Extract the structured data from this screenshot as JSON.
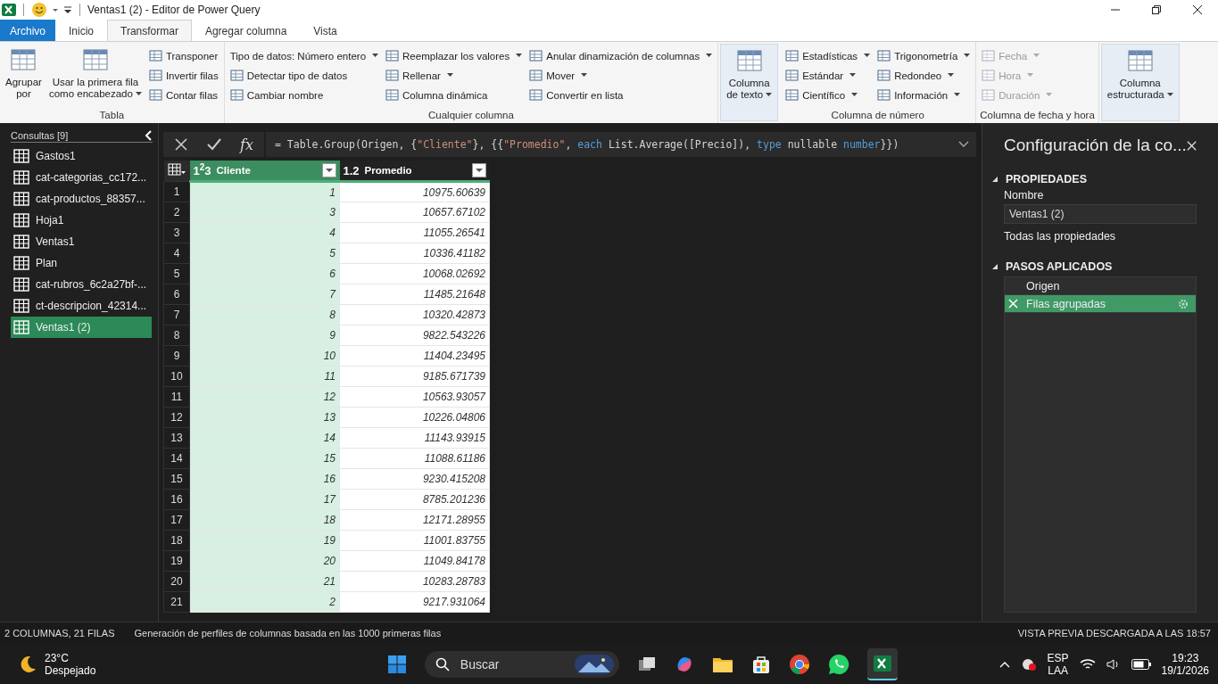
{
  "window": {
    "title": "Ventas1 (2) - Editor de Power Query"
  },
  "tabs": [
    {
      "label": "Archivo",
      "kind": "file",
      "selected": false
    },
    {
      "label": "Inicio",
      "kind": "tab",
      "selected": false
    },
    {
      "label": "Transformar",
      "kind": "tab",
      "selected": true
    },
    {
      "label": "Agregar columna",
      "kind": "tab",
      "selected": false
    },
    {
      "label": "Vista",
      "kind": "tab",
      "selected": false
    }
  ],
  "ribbon": [
    {
      "label": "Tabla",
      "highlighted": false,
      "columns": [
        {
          "kind": "large",
          "items": [
            {
              "label": "Agrupar\npor",
              "dropdown": false,
              "disabled": false
            }
          ]
        },
        {
          "kind": "large",
          "items": [
            {
              "label": "Usar la primera fila\ncomo encabezado",
              "dropdown": true,
              "disabled": false
            }
          ]
        },
        {
          "kind": "stack",
          "items": [
            {
              "label": "Transponer",
              "dropdown": false,
              "disabled": false,
              "kind": "icon"
            },
            {
              "label": "Invertir filas",
              "dropdown": false,
              "disabled": false,
              "kind": "icon"
            },
            {
              "label": "Contar filas",
              "dropdown": false,
              "disabled": false,
              "kind": "icon"
            }
          ]
        }
      ]
    },
    {
      "label": "Cualquier columna",
      "highlighted": false,
      "columns": [
        {
          "kind": "stack",
          "items": [
            {
              "label": "Tipo de datos: Número entero",
              "dropdown": true,
              "disabled": false,
              "kind": "plain"
            },
            {
              "label": "Detectar tipo de datos",
              "dropdown": false,
              "disabled": false,
              "kind": "icon"
            },
            {
              "label": "Cambiar nombre",
              "dropdown": false,
              "disabled": false,
              "kind": "icon"
            }
          ]
        },
        {
          "kind": "stack",
          "items": [
            {
              "label": "Reemplazar los valores",
              "dropdown": true,
              "disabled": false,
              "kind": "icon"
            },
            {
              "label": "Rellenar",
              "dropdown": true,
              "disabled": false,
              "kind": "icon"
            },
            {
              "label": "Columna dinámica",
              "dropdown": false,
              "disabled": false,
              "kind": "icon"
            }
          ]
        },
        {
          "kind": "stack",
          "items": [
            {
              "label": "Anular dinamización de columnas",
              "dropdown": true,
              "disabled": false,
              "kind": "icon"
            },
            {
              "label": "Mover",
              "dropdown": true,
              "disabled": false,
              "kind": "icon"
            },
            {
              "label": "Convertir en lista",
              "dropdown": false,
              "disabled": false,
              "kind": "icon"
            }
          ]
        }
      ]
    },
    {
      "highlighted": true,
      "columns": [
        {
          "kind": "large",
          "items": [
            {
              "label": "Columna\nde texto",
              "dropdown": true,
              "disabled": false
            }
          ]
        }
      ]
    },
    {
      "label": "Columna de número",
      "highlighted": false,
      "columns": [
        {
          "kind": "stack",
          "items": [
            {
              "label": "Estadísticas",
              "dropdown": true,
              "disabled": false,
              "kind": "icon"
            },
            {
              "label": "Estándar",
              "dropdown": true,
              "disabled": false,
              "kind": "icon"
            },
            {
              "label": "Científico",
              "dropdown": true,
              "disabled": false,
              "kind": "icon"
            }
          ]
        },
        {
          "kind": "stack",
          "items": [
            {
              "label": "Trigonometría",
              "dropdown": true,
              "disabled": false,
              "kind": "icon"
            },
            {
              "label": "Redondeo",
              "dropdown": true,
              "disabled": false,
              "kind": "icon"
            },
            {
              "label": "Información",
              "dropdown": true,
              "disabled": false,
              "kind": "icon"
            }
          ]
        }
      ]
    },
    {
      "label": "Columna de fecha y hora",
      "highlighted": false,
      "columns": [
        {
          "kind": "stack",
          "items": [
            {
              "label": "Fecha",
              "dropdown": true,
              "disabled": true,
              "kind": "icon"
            },
            {
              "label": "Hora",
              "dropdown": true,
              "disabled": true,
              "kind": "icon"
            },
            {
              "label": "Duración",
              "dropdown": true,
              "disabled": true,
              "kind": "icon"
            }
          ]
        }
      ]
    },
    {
      "highlighted": true,
      "columns": [
        {
          "kind": "large",
          "items": [
            {
              "label": "Columna\nestructurada",
              "dropdown": true,
              "disabled": false
            }
          ]
        }
      ]
    }
  ],
  "queries": {
    "title": "Consultas [9]",
    "items": [
      {
        "label": "Gastos1",
        "selected": false
      },
      {
        "label": "cat-categorias_cc172...",
        "selected": false
      },
      {
        "label": "cat-productos_88357...",
        "selected": false
      },
      {
        "label": "Hoja1",
        "selected": false
      },
      {
        "label": "Ventas1",
        "selected": false
      },
      {
        "label": "Plan",
        "selected": false
      },
      {
        "label": "cat-rubros_6c2a27bf-...",
        "selected": false
      },
      {
        "label": "ct-descripcion_42314...",
        "selected": false
      },
      {
        "label": "Ventas1 (2)",
        "selected": true
      }
    ]
  },
  "formula": {
    "prefix": "fx",
    "segments": [
      {
        "text": "= Table.Group(Origen, {",
        "kind": "plain"
      },
      {
        "text": "\"Cliente\"",
        "kind": "string"
      },
      {
        "text": "}, {{",
        "kind": "plain"
      },
      {
        "text": "\"Promedio\"",
        "kind": "string"
      },
      {
        "text": ", ",
        "kind": "plain"
      },
      {
        "text": "each",
        "kind": "keyword"
      },
      {
        "text": " List.Average([Precio]), ",
        "kind": "plain"
      },
      {
        "text": "type",
        "kind": "keyword"
      },
      {
        "text": " nullable ",
        "kind": "plain"
      },
      {
        "text": "number",
        "kind": "keyword"
      },
      {
        "text": "}})",
        "kind": "plain"
      }
    ]
  },
  "table": {
    "columns": [
      {
        "type": "1$^{2}$3",
        "name": "Cliente",
        "selected": true
      },
      {
        "type": "1.2",
        "name": "Promedio",
        "selected": false
      }
    ],
    "rows": [
      {
        "row_number": "1",
        "cells": [
          "1",
          "10975.60639"
        ]
      },
      {
        "row_number": "2",
        "cells": [
          "3",
          "10657.67102"
        ]
      },
      {
        "row_number": "3",
        "cells": [
          "4",
          "11055.26541"
        ]
      },
      {
        "row_number": "4",
        "cells": [
          "5",
          "10336.41182"
        ]
      },
      {
        "row_number": "5",
        "cells": [
          "6",
          "10068.02692"
        ]
      },
      {
        "row_number": "6",
        "cells": [
          "7",
          "11485.21648"
        ]
      },
      {
        "row_number": "7",
        "cells": [
          "8",
          "10320.42873"
        ]
      },
      {
        "row_number": "8",
        "cells": [
          "9",
          "9822.543226"
        ]
      },
      {
        "row_number": "9",
        "cells": [
          "10",
          "11404.23495"
        ]
      },
      {
        "row_number": "10",
        "cells": [
          "11",
          "9185.671739"
        ]
      },
      {
        "row_number": "11",
        "cells": [
          "12",
          "10563.93057"
        ]
      },
      {
        "row_number": "12",
        "cells": [
          "13",
          "10226.04806"
        ]
      },
      {
        "row_number": "13",
        "cells": [
          "14",
          "11143.93915"
        ]
      },
      {
        "row_number": "14",
        "cells": [
          "15",
          "11088.61186"
        ]
      },
      {
        "row_number": "15",
        "cells": [
          "16",
          "9230.415208"
        ]
      },
      {
        "row_number": "16",
        "cells": [
          "17",
          "8785.201236"
        ]
      },
      {
        "row_number": "17",
        "cells": [
          "18",
          "12171.28955"
        ]
      },
      {
        "row_number": "18",
        "cells": [
          "19",
          "11001.83755"
        ]
      },
      {
        "row_number": "19",
        "cells": [
          "20",
          "11049.84178"
        ]
      },
      {
        "row_number": "20",
        "cells": [
          "21",
          "10283.28783"
        ]
      },
      {
        "row_number": "21",
        "cells": [
          "2",
          "9217.931064"
        ]
      }
    ]
  },
  "settings": {
    "title": "Configuración de la co...",
    "properties_heading": "PROPIEDADES",
    "name_label": "Nombre",
    "name_value": "Ventas1 (2)",
    "all_properties": "Todas las propiedades",
    "steps_heading": "PASOS APLICADOS",
    "steps": [
      {
        "label": "Origen",
        "selected": false,
        "deletable": false,
        "gear": false
      },
      {
        "label": "Filas agrupadas",
        "selected": true,
        "deletable": true,
        "gear": true
      }
    ]
  },
  "status_bar": {
    "counts": "2 COLUMNAS, 21 FILAS",
    "profiling": "Generación de perfiles de columnas basada en las 1000 primeras filas",
    "preview": "VISTA PREVIA DESCARGADA A LAS 18:57"
  },
  "taskbar": {
    "temperature": "23°C",
    "weather": "Despejado",
    "search_placeholder": "Buscar",
    "language": "ESP",
    "layout": "LAA",
    "time": "19:23",
    "date": "19/1/2026"
  }
}
